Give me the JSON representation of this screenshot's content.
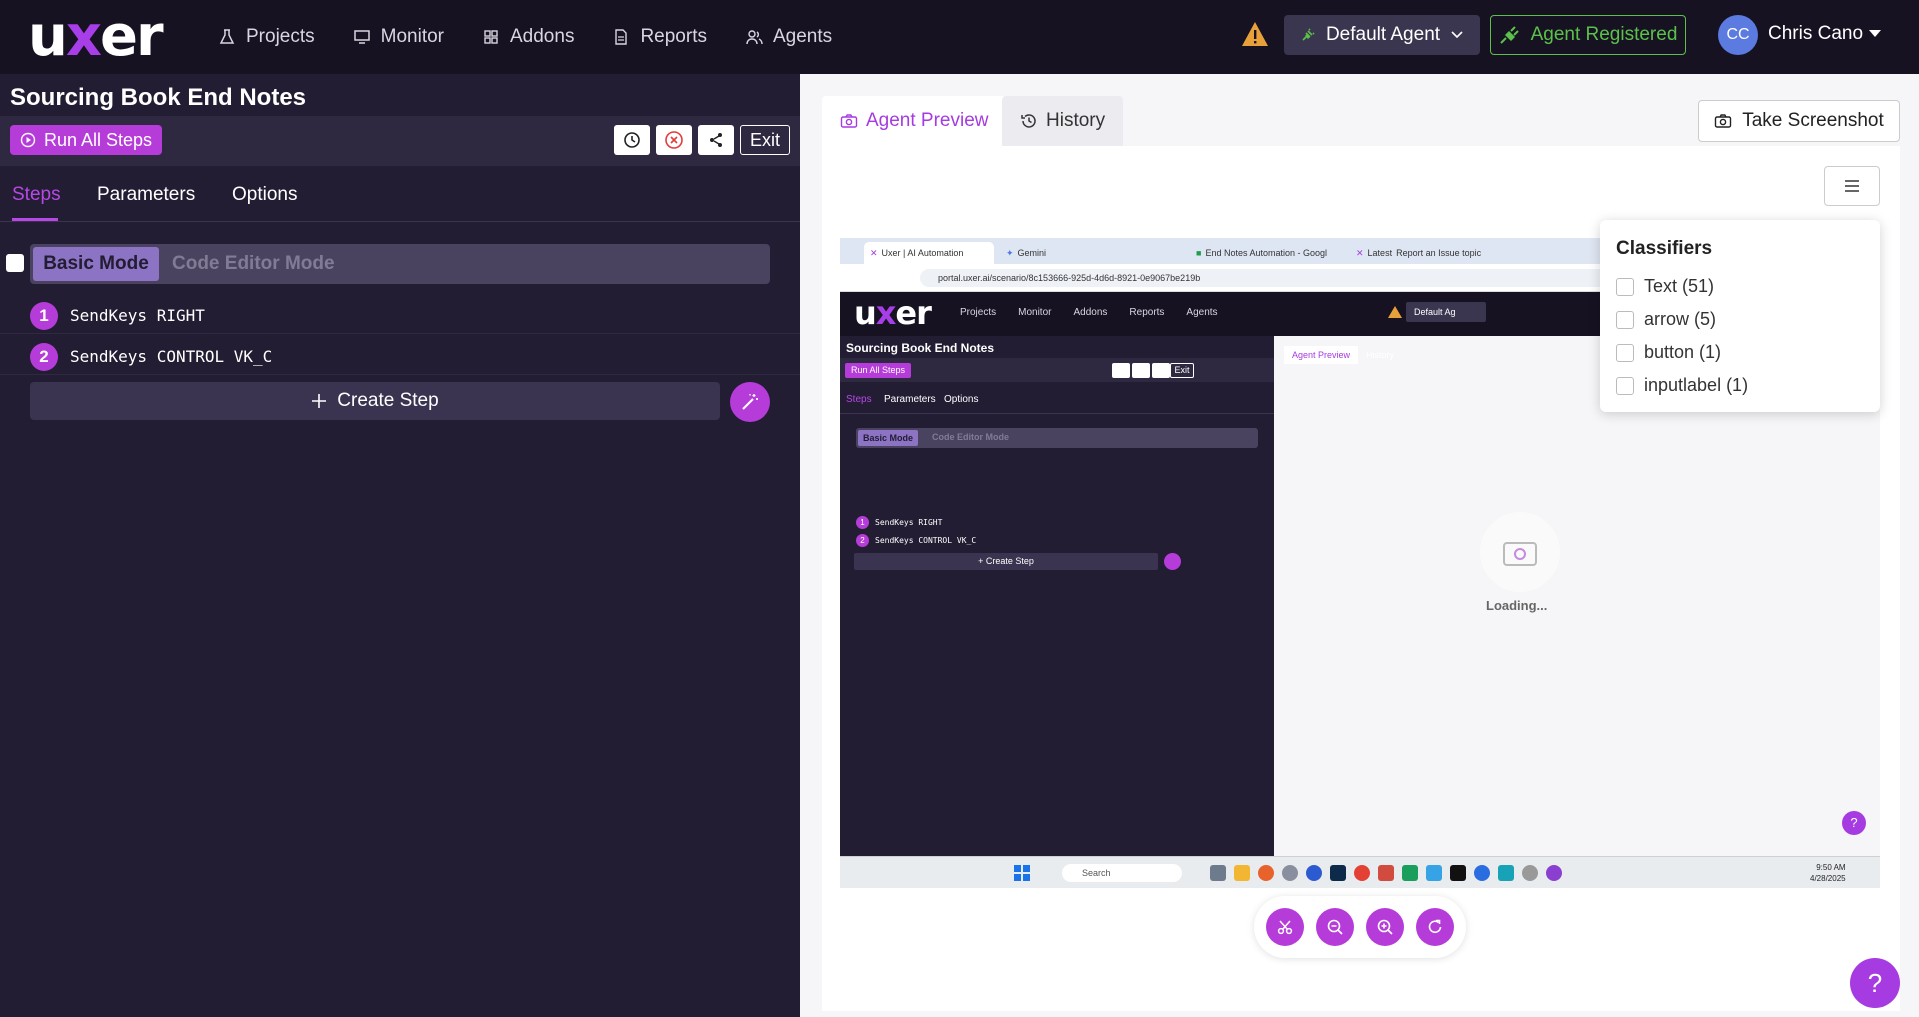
{
  "brand": {
    "logo_pre": "u",
    "logo_x": "x",
    "logo_post": "er"
  },
  "nav": [
    {
      "label": "Projects",
      "icon": "flask-icon"
    },
    {
      "label": "Monitor",
      "icon": "monitor-icon"
    },
    {
      "label": "Addons",
      "icon": "grid-icon"
    },
    {
      "label": "Reports",
      "icon": "report-icon"
    },
    {
      "label": "Agents",
      "icon": "agents-icon"
    }
  ],
  "header": {
    "agent_select": "Default Agent",
    "agent_status": "Agent Registered",
    "user_initials": "CC",
    "user_name": "Chris Cano"
  },
  "scenario": {
    "title": "Sourcing Book End Notes",
    "run_all": "Run All Steps",
    "exit": "Exit",
    "tabs": [
      "Steps",
      "Parameters",
      "Options"
    ],
    "modes": {
      "basic": "Basic Mode",
      "code": "Code Editor Mode"
    },
    "steps": [
      {
        "num": "1",
        "text": "SendKeys RIGHT"
      },
      {
        "num": "2",
        "text": "SendKeys CONTROL VK_C"
      }
    ],
    "create_step": "Create Step"
  },
  "preview": {
    "tab_agent": "Agent Preview",
    "tab_history": "History",
    "take_screenshot": "Take Screenshot",
    "loading": "Loading...",
    "help": "?"
  },
  "classifiers": {
    "title": "Classifiers",
    "items": [
      "Text (51)",
      "arrow (5)",
      "button (1)",
      "inputlabel (1)"
    ]
  },
  "mini": {
    "tabs": [
      "Uxer | AI Automation",
      "Gemini",
      "End Notes Automation - Googl",
      "Latest",
      "Report an Issue topic"
    ],
    "url": "portal.uxer.ai/scenario/8c153666-925d-4d6d-8921-0e9067be219b",
    "agent": "Default Ag",
    "search": "Search",
    "time": "9:50 AM",
    "date": "4/28/2025"
  },
  "colors": {
    "accent": "#b63cd9",
    "success": "#5cc14a",
    "warning": "#e8a13a",
    "dark": "#161222"
  }
}
